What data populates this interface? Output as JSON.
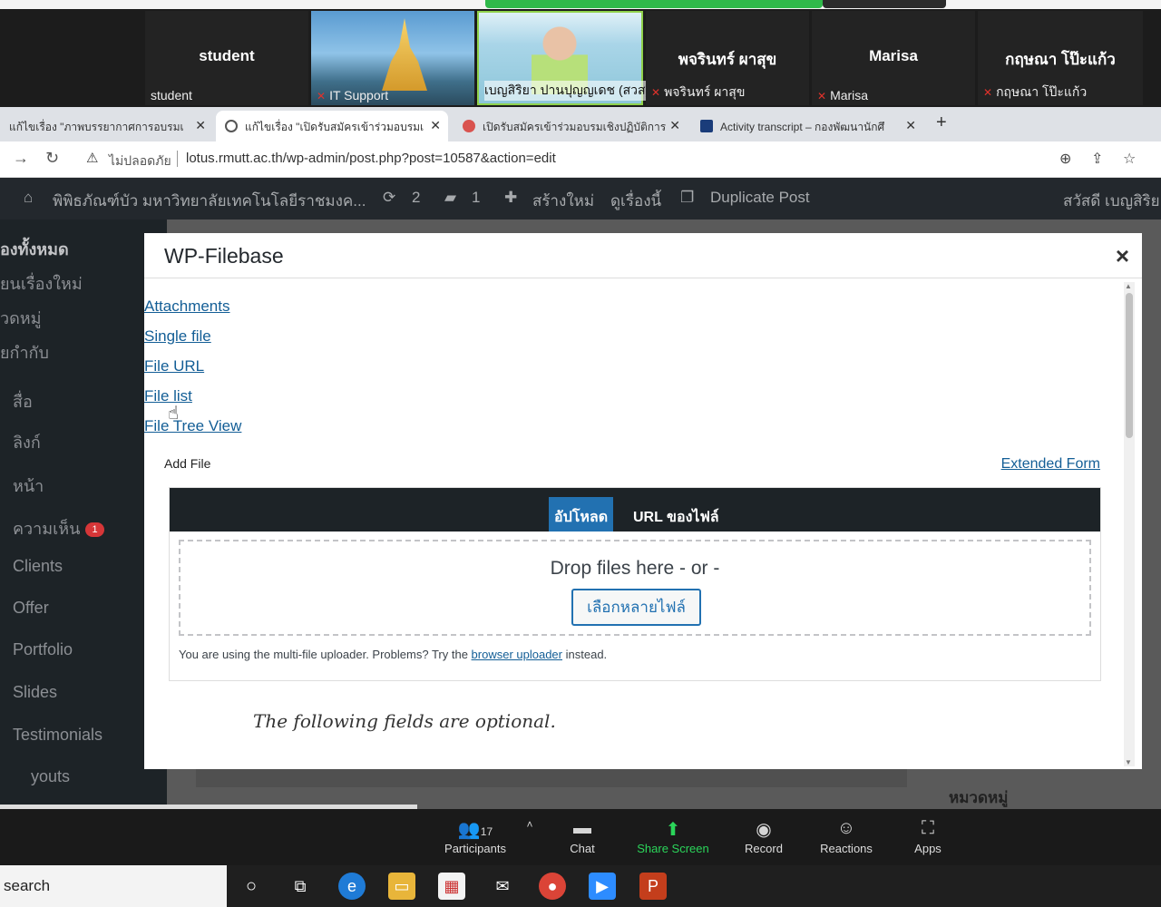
{
  "zoom_top": {
    "participants": [
      {
        "name": "student",
        "label": "student"
      },
      {
        "name": "",
        "label": "IT Support"
      },
      {
        "name": "",
        "label": "เบญสิริยา ปานปุญญเดช (สวส)"
      },
      {
        "name": "พจรินทร์ ผาสุข",
        "label": "พจรินทร์ ผาสุข"
      },
      {
        "name": "Marisa",
        "label": "Marisa"
      },
      {
        "name": "กฤษณา โป๊ะแก้ว",
        "label": "กฤษณา โป๊ะแก้ว"
      }
    ]
  },
  "browser": {
    "tabs": [
      {
        "title": "แก้ไขเรื่อง \"ภาพบรรยากาศการอบรมเ",
        "active": false
      },
      {
        "title": "แก้ไขเรื่อง \"เปิดรับสมัครเข้าร่วมอบรมเ",
        "active": true
      },
      {
        "title": "เปิดรับสมัครเข้าร่วมอบรมเชิงปฏิบัติการ",
        "active": false
      },
      {
        "title": "Activity transcript – กองพัฒนานักศึ",
        "active": false
      }
    ],
    "insecure_label": "ไม่ปลอดภัย",
    "url": "lotus.rmutt.ac.th/wp-admin/post.php?post=10587&action=edit"
  },
  "wp_admin_bar": {
    "site_name": "พิพิธภัณฑ์บัว มหาวิทยาลัยเทคโนโลยีราชมงค...",
    "updates_count": "2",
    "comments_count": "1",
    "new_label": "สร้างใหม่",
    "view_label": "ดูเรื่องนี้",
    "duplicate_label": "Duplicate Post",
    "greeting": "สวัสดี เบญสิริย"
  },
  "wp_sidebar": {
    "items": [
      "องทั้งหมด",
      "ยนเรื่องใหม่",
      "วดหมู่",
      "ยกำกับ",
      "สื่อ",
      "ลิงก์",
      "หน้า",
      "ความเห็น",
      "Clients",
      "Offer",
      "Portfolio",
      "Slides",
      "Testimonials",
      "youts"
    ],
    "comments_badge": "1"
  },
  "modal": {
    "title": "WP-Filebase",
    "close": "×",
    "links": [
      "Attachments",
      "Single file",
      "File URL",
      "File list",
      "File Tree View"
    ],
    "add_file_label": "Add File",
    "extended_form_label": "Extended Form",
    "uploader": {
      "tab_upload": "อัปโหลด",
      "tab_url": "URL ของไฟล์",
      "drop_text": "Drop files here - or -",
      "select_button": "เลือกหลายไฟล์",
      "info_prefix": "You are using the multi-file uploader. Problems? Try the",
      "info_link": "browser uploader",
      "info_suffix": "instead."
    },
    "optional_text": "The following fields are optional."
  },
  "below_modal": {
    "category_label": "หมวดหมู่"
  },
  "zoom_toolbar": {
    "participants_label": "Participants",
    "participants_count": "17",
    "chat_label": "Chat",
    "share_label": "Share Screen",
    "record_label": "Record",
    "reactions_label": "Reactions",
    "apps_label": "Apps"
  },
  "taskbar": {
    "search_text": "search"
  }
}
